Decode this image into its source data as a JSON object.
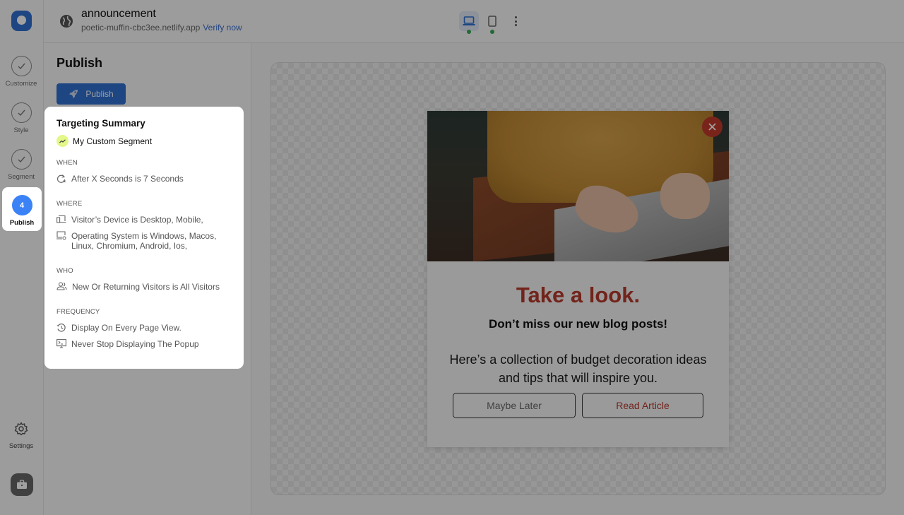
{
  "app": {
    "site_title": "announcement",
    "site_url": "poetic-muffin-cbc3ee.netlify.app",
    "verify_label": "Verify now",
    "brand_color": "#2f6fd0"
  },
  "toolbar": {
    "devices": [
      {
        "name": "desktop",
        "icon": "laptop-icon",
        "active": true,
        "status": "green"
      },
      {
        "name": "mobile",
        "icon": "phone-icon",
        "active": false,
        "status": "green"
      }
    ],
    "more_icon": "kebab-icon"
  },
  "rail": {
    "steps": [
      {
        "label": "Customize",
        "state": "done",
        "icon": "check-icon"
      },
      {
        "label": "Style",
        "state": "done",
        "icon": "check-icon"
      },
      {
        "label": "Segment",
        "state": "done",
        "icon": "check-icon"
      },
      {
        "label": "Publish",
        "state": "active",
        "number": "4"
      }
    ],
    "settings_label": "Settings",
    "briefcase_icon": "briefcase-icon"
  },
  "panel": {
    "title": "Publish",
    "publish_button": "Publish"
  },
  "summary": {
    "title": "Targeting Summary",
    "segment": "My Custom Segment",
    "sections": {
      "when": {
        "label": "WHEN",
        "items": [
          "After X Seconds is 7 Seconds"
        ]
      },
      "where": {
        "label": "WHERE",
        "items": [
          "Visitor’s Device is Desktop, Mobile,",
          "Operating System is Windows, Macos, Linux, Chromium, Android, Ios,"
        ]
      },
      "who": {
        "label": "WHO",
        "items": [
          "New Or Returning Visitors is All Visitors"
        ]
      },
      "frequency": {
        "label": "FREQUENCY",
        "items": [
          "Display On Every Page View.",
          "Never Stop Displaying The Popup"
        ]
      }
    }
  },
  "popup": {
    "heading": "Take a look.",
    "subheading": "Don’t miss our new blog posts!",
    "body": "Here’s a collection of budget decoration ideas and tips that will inspire you.",
    "secondary_button": "Maybe Later",
    "primary_button": "Read Article",
    "accent_color": "#b5392c",
    "close_icon": "close-icon"
  }
}
